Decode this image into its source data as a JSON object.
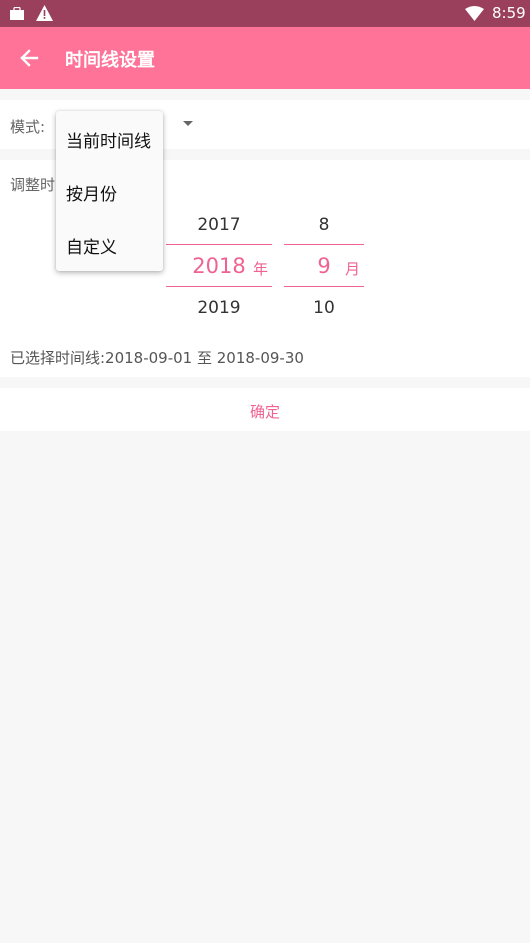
{
  "status_bar": {
    "time": "8:59"
  },
  "app_bar": {
    "title": "时间线设置"
  },
  "mode": {
    "label": "模式:"
  },
  "dropdown": {
    "items": [
      "当前时间线",
      "按月份",
      "自定义"
    ]
  },
  "adjust": {
    "label": "调整时间线:"
  },
  "picker": {
    "year": {
      "prev": "2017",
      "selected": "2018",
      "next": "2019",
      "unit": "年"
    },
    "month": {
      "prev": "8",
      "selected": "9",
      "next": "10",
      "unit": "月"
    }
  },
  "selected_range": "已选择时间线:2018-09-01 至 2018-09-30",
  "confirm_label": "确定",
  "colors": {
    "status_bar": "#9a3f5c",
    "app_bar": "#fe7397",
    "accent": "#f06292",
    "background": "#f7f7f7"
  }
}
